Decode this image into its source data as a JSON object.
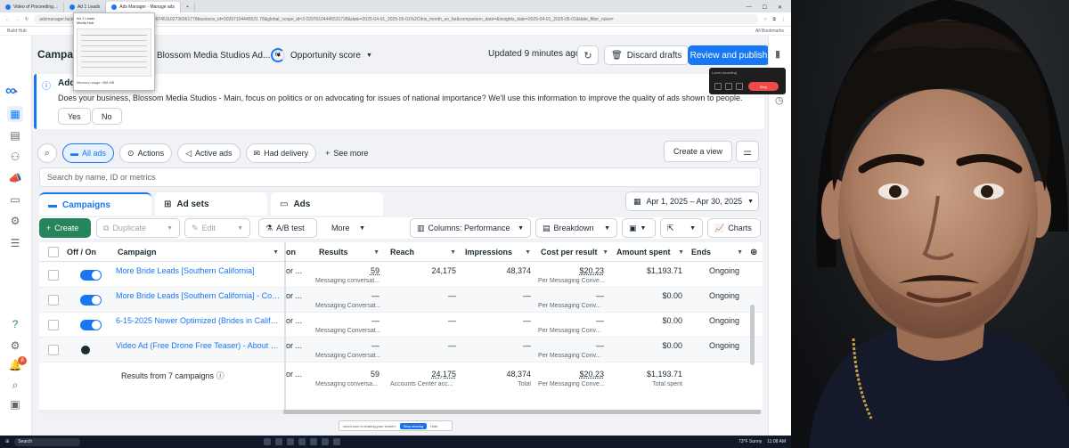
{
  "browser": {
    "tabs": [
      {
        "label": "Video of Proceeding…"
      },
      {
        "label": "Ad 1 Leads"
      },
      {
        "label": "Ads Manager - Manage ads"
      }
    ],
    "url": "adsmanager.facebook.com/adsmanager/manage/ads?act=97451102736961778business_id=30297104445531 78&global_scope_id=3 02970104445531728&date=2025-04-01_2025-05-01%2Cthis_month_so_far&comparison_date=&insights_date=2025-04-01_2025-05-01&date_filter_rules=",
    "bookmarks_left": "Build Hub",
    "bookmarks_right": "All Bookmarks",
    "popup": {
      "title": "Ad 1 Leads",
      "sub": "Media Hub",
      "memory": "Memory usage: 968 MB"
    }
  },
  "header": {
    "title": "Campaigns",
    "account": "Blossom Media Studios Ad...",
    "opportunity_value": "61",
    "opportunity_label": "Opportunity score",
    "updated": "Updated 9 minutes ago",
    "discard": "Discard drafts",
    "review": "Review and publish"
  },
  "notice": {
    "title": "Addi",
    "text": "Does your business, Blossom Media Studios - Main, focus on politics or on advocating for issues of national importance? We'll use this information to improve the quality of ads shown to people.",
    "yes": "Yes",
    "no": "No"
  },
  "filters": {
    "chips": [
      {
        "label": "All ads"
      },
      {
        "label": "Actions"
      },
      {
        "label": "Active ads"
      },
      {
        "label": "Had delivery"
      }
    ],
    "see_more": "See more",
    "create_view": "Create a view"
  },
  "search": {
    "placeholder": "Search by name, ID or metrics"
  },
  "levels": {
    "campaigns": "Campaigns",
    "adsets": "Ad sets",
    "ads": "Ads"
  },
  "date_range": "Apr 1, 2025 – Apr 30, 2025",
  "toolbar": {
    "create": "Create",
    "duplicate": "Duplicate",
    "edit": "Edit",
    "ab_test": "A/B test",
    "more": "More",
    "columns": "Columns: Performance",
    "breakdown": "Breakdown",
    "charts": "Charts"
  },
  "table": {
    "headers": {
      "offon": "Off / On",
      "campaign": "Campaign",
      "on": "on",
      "results": "Results",
      "reach": "Reach",
      "impressions": "Impressions",
      "cpr": "Cost per result",
      "amount": "Amount spent",
      "ends": "Ends"
    },
    "rows": [
      {
        "name": "More Bride Leads [Southern California]",
        "on": "or ...",
        "results": "59",
        "results_sub": "Messaging conversat...",
        "reach": "24,175",
        "impressions": "48,374",
        "cpr": "$20.23",
        "cpr_sub": "Per Messaging Conve...",
        "amount": "$1,193.71",
        "ends": "Ongoing"
      },
      {
        "name": "More Bride Leads [Southern California] - Cop...",
        "on": "or ...",
        "results": "—",
        "results_sub": "Messaging Conversat...",
        "reach": "—",
        "impressions": "—",
        "cpr": "—",
        "cpr_sub": "Per Messaging Conv...",
        "amount": "$0.00",
        "ends": "Ongoing"
      },
      {
        "name": "6-15-2025 Newer Optimized (Brides in Califor...",
        "on": "or ...",
        "results": "—",
        "results_sub": "Messaging Conversat...",
        "reach": "—",
        "impressions": "—",
        "cpr": "—",
        "cpr_sub": "Per Messaging Conv...",
        "amount": "$0.00",
        "ends": "Ongoing"
      },
      {
        "name": "Video Ad (Free Drone Free Teaser) - About Us...",
        "on": "or ...",
        "results": "—",
        "results_sub": "Messaging Conversat...",
        "reach": "—",
        "impressions": "—",
        "cpr": "—",
        "cpr_sub": "Per Messaging Conv...",
        "amount": "$0.00",
        "ends": "Ongoing"
      }
    ],
    "total": {
      "label": "Results from 7 campaigns",
      "on": "or ...",
      "results": "59",
      "results_sub": "Messaging conversa...",
      "reach": "24,175",
      "reach_sub": "Accounts Center acc...",
      "impressions": "48,374",
      "impressions_sub": "Total",
      "cpr": "$20.23",
      "cpr_sub": "Per Messaging Conve...",
      "amount": "$1,193.71",
      "amount_sub": "Total spent"
    }
  },
  "notifications_badge": "8",
  "recorder": {
    "title": "Loom recording",
    "stop": "Stop"
  },
  "share_bar": {
    "text": "zoom.com is sharing your screen.",
    "stop": "Stop sharing",
    "hide": "Hide"
  },
  "taskbar": {
    "search": "Search",
    "weather": "73°F Sunny",
    "time": "11:08 AM"
  },
  "colors": {
    "meta_blue": "#1877f2",
    "create_green": "#28845a"
  }
}
